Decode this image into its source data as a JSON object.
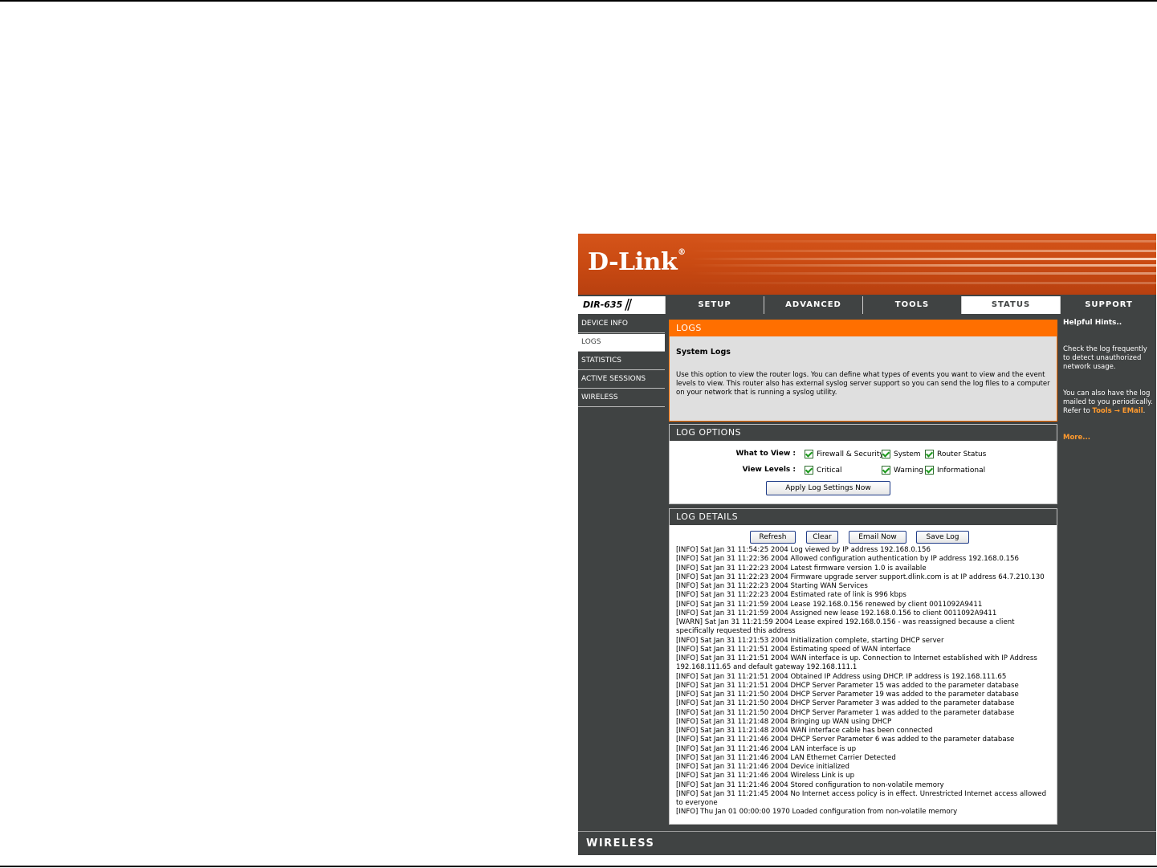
{
  "brand": {
    "logo": "D-Link",
    "model": "DIR-635",
    "footer": "WIRELESS"
  },
  "nav": {
    "tabs": [
      "SETUP",
      "ADVANCED",
      "TOOLS",
      "STATUS",
      "SUPPORT"
    ],
    "active": "STATUS"
  },
  "sidebar": {
    "items": [
      "DEVICE INFO",
      "LOGS",
      "STATISTICS",
      "ACTIVE SESSIONS",
      "WIRELESS"
    ],
    "active": "LOGS"
  },
  "intro": {
    "header": "LOGS",
    "title": "System Logs",
    "description": "Use this option to view the router logs. You can define what types of events you want to view and the event levels to view. This router also has external syslog server support so you can send the log files to a computer on your network that is running a syslog utility."
  },
  "log_options": {
    "header": "LOG OPTIONS",
    "what_to_view_label": "What to View :",
    "view_levels_label": "View Levels :",
    "what_to_view": [
      "Firewall & Security",
      "System",
      "Router Status"
    ],
    "view_levels": [
      "Critical",
      "Warning",
      "Informational"
    ],
    "apply_label": "Apply Log Settings Now"
  },
  "log_details": {
    "header": "LOG DETAILS",
    "buttons": {
      "refresh": "Refresh",
      "clear": "Clear",
      "email": "Email Now",
      "save": "Save Log"
    },
    "lines": [
      "[INFO] Sat Jan 31 11:54:25 2004 Log viewed by IP address 192.168.0.156",
      "[INFO] Sat Jan 31 11:22:36 2004 Allowed configuration authentication by IP address 192.168.0.156",
      "[INFO] Sat Jan 31 11:22:23 2004 Latest firmware version 1.0 is available",
      "[INFO] Sat Jan 31 11:22:23 2004 Firmware upgrade server support.dlink.com is at IP address 64.7.210.130",
      "[INFO] Sat Jan 31 11:22:23 2004 Starting WAN Services",
      "[INFO] Sat Jan 31 11:22:23 2004 Estimated rate of link is 996 kbps",
      "[INFO] Sat Jan 31 11:21:59 2004 Lease 192.168.0.156 renewed by client 0011092A9411",
      "[INFO] Sat Jan 31 11:21:59 2004 Assigned new lease 192.168.0.156 to client 0011092A9411",
      "[WARN] Sat Jan 31 11:21:59 2004 Lease expired 192.168.0.156 - was reassigned because a client specifically requested this address",
      "[INFO] Sat Jan 31 11:21:53 2004 Initialization complete, starting DHCP server",
      "[INFO] Sat Jan 31 11:21:51 2004 Estimating speed of WAN interface",
      "[INFO] Sat Jan 31 11:21:51 2004 WAN interface is up. Connection to Internet established with IP Address 192.168.111.65 and default gateway 192.168.111.1",
      "[INFO] Sat Jan 31 11:21:51 2004 Obtained IP Address using DHCP. IP address is 192.168.111.65",
      "[INFO] Sat Jan 31 11:21:51 2004 DHCP Server Parameter 15 was added to the parameter database",
      "[INFO] Sat Jan 31 11:21:50 2004 DHCP Server Parameter 19 was added to the parameter database",
      "[INFO] Sat Jan 31 11:21:50 2004 DHCP Server Parameter 3 was added to the parameter database",
      "[INFO] Sat Jan 31 11:21:50 2004 DHCP Server Parameter 1 was added to the parameter database",
      "[INFO] Sat Jan 31 11:21:48 2004 Bringing up WAN using DHCP",
      "[INFO] Sat Jan 31 11:21:48 2004 WAN interface cable has been connected",
      "[INFO] Sat Jan 31 11:21:46 2004 DHCP Server Parameter 6 was added to the parameter database",
      "[INFO] Sat Jan 31 11:21:46 2004 LAN interface is up",
      "[INFO] Sat Jan 31 11:21:46 2004 LAN Ethernet Carrier Detected",
      "[INFO] Sat Jan 31 11:21:46 2004 Device initialized",
      "[INFO] Sat Jan 31 11:21:46 2004 Wireless Link is up",
      "[INFO] Sat Jan 31 11:21:46 2004 Stored configuration to non-volatile memory",
      "[INFO] Sat Jan 31 11:21:45 2004 No Internet access policy is in effect. Unrestricted Internet access allowed to everyone",
      "[INFO] Thu Jan 01 00:00:00 1970 Loaded configuration from non-volatile memory"
    ]
  },
  "hints": {
    "title": "Helpful Hints..",
    "p1": "Check the log frequently to detect unauthorized network usage.",
    "p2_prefix": "You can also have the log mailed to you periodically. Refer to",
    "p2_link": "Tools → EMail",
    "more": "More..."
  },
  "colors": {
    "orange": "#ff6f00",
    "dark": "#404343",
    "banner": "#c94a12"
  }
}
